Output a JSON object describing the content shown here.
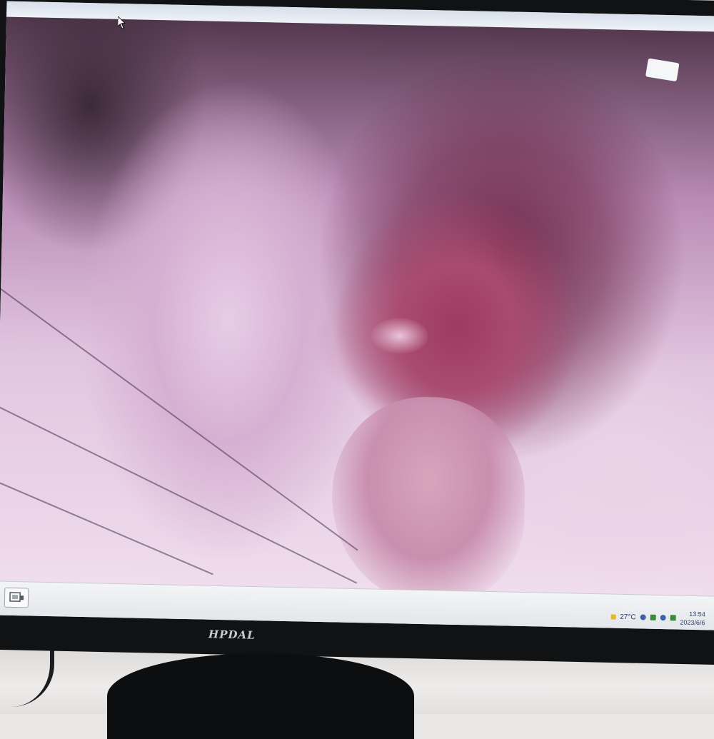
{
  "window": {
    "title": ""
  },
  "taskbar": {
    "start_icon": "app-icon",
    "weather": "27°C",
    "clock_time": "13:54",
    "clock_date": "2023/6/6"
  },
  "monitor": {
    "brand": "HPDAL"
  },
  "icons": [
    "cursor-icon",
    "sun-icon",
    "help-icon",
    "network-icon",
    "volume-icon",
    "action-center-icon"
  ]
}
